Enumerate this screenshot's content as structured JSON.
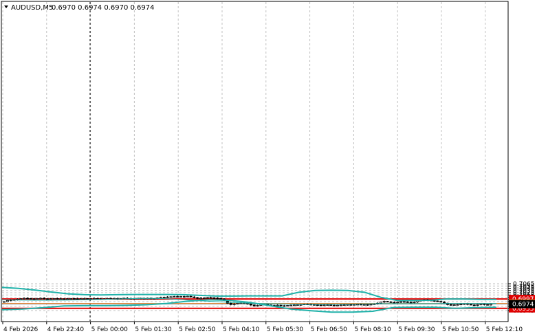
{
  "chart_data": {
    "type": "candlestick",
    "title": "AUDUSD,M5",
    "ohlc_header": "0.6970 0.6974 0.6970 0.6974",
    "ylim": [
      0.694,
      0.7071
    ],
    "yticks": [
      "0.7065",
      "0.7055",
      "0.7045",
      "0.7035",
      "0.7025",
      "0.7015",
      "0.7005",
      "0.6995",
      "0.6985",
      "0.6975",
      "0.6965",
      "0.6955",
      "0.6945"
    ],
    "xticks": [
      "4 Feb 2026",
      "4 Feb 22:40",
      "5 Feb 00:00",
      "5 Feb 01:30",
      "5 Feb 02:50",
      "5 Feb 04:10",
      "5 Feb 05:30",
      "5 Feb 06:50",
      "5 Feb 08:10",
      "5 Feb 09:30",
      "5 Feb 10:50",
      "5 Feb 12:10"
    ],
    "grid": true,
    "levels": [
      {
        "price": 0.6997,
        "label": "0.6997",
        "color": "#e00000",
        "style": "solid-thick"
      },
      {
        "price": 0.6977,
        "label": "0.6977",
        "color": "#e8791e",
        "style": "solid-thin"
      },
      {
        "price": 0.6955,
        "label": "0.6955",
        "color": "#e00000",
        "style": "solid-thick"
      }
    ],
    "current_price": {
      "price": 0.6974,
      "label": "0.6974"
    },
    "candles_close": [
      0.6985,
      0.699,
      0.6993,
      0.6994,
      0.6996,
      0.6998,
      0.7,
      0.6999,
      0.6998,
      0.6997,
      0.6999,
      0.7,
      0.6998,
      0.6997,
      0.6998,
      0.6999,
      0.6997,
      0.6998,
      0.6996,
      0.6998,
      0.6999,
      0.6998,
      0.6997,
      0.6998,
      0.6999,
      0.6998,
      0.6997,
      0.6999,
      0.6998,
      0.6997,
      0.6998,
      0.6999,
      0.6998,
      0.6999,
      0.6997,
      0.6999,
      0.7,
      0.6999,
      0.6998,
      0.6999,
      0.7,
      0.6998,
      0.6999,
      0.7,
      0.6999,
      0.6998,
      0.7001,
      0.7003,
      0.7005,
      0.7006,
      0.7007,
      0.7008,
      0.7007,
      0.7008,
      0.7007,
      0.7009,
      0.7006,
      0.7003,
      0.7,
      0.7001,
      0.7002,
      0.7003,
      0.7002,
      0.7001,
      0.7,
      0.6997,
      0.699,
      0.6978,
      0.6972,
      0.6975,
      0.6978,
      0.698,
      0.6978,
      0.6975,
      0.697,
      0.6965,
      0.6968,
      0.6972,
      0.6973,
      0.697,
      0.6968,
      0.6967,
      0.6969,
      0.6967,
      0.6966,
      0.6968,
      0.6969,
      0.697,
      0.6971,
      0.6972,
      0.6974,
      0.6973,
      0.6972,
      0.6971,
      0.697,
      0.6969,
      0.697,
      0.6971,
      0.6969,
      0.6968,
      0.6969,
      0.697,
      0.6971,
      0.6972,
      0.6971,
      0.6972,
      0.6973,
      0.6972,
      0.6972,
      0.6971,
      0.6973,
      0.6975,
      0.6978,
      0.6983,
      0.6986,
      0.6984,
      0.6982,
      0.6981,
      0.6983,
      0.6985,
      0.6984,
      0.6982,
      0.6981,
      0.6983,
      0.6988,
      0.6991,
      0.6993,
      0.6992,
      0.699,
      0.6988,
      0.6986,
      0.6983,
      0.6978,
      0.6972,
      0.697,
      0.6971,
      0.6972,
      0.6974,
      0.6976,
      0.6973,
      0.697,
      0.6968,
      0.6972,
      0.6975,
      0.6972,
      0.697,
      0.6974
    ],
    "series": [
      {
        "name": "",
        "color": "#20b2aa",
        "values": [
          0.7049,
          0.7044,
          0.7037,
          0.7028,
          0.702,
          0.7016,
          0.7015,
          0.7016,
          0.7017,
          0.7017,
          0.7017,
          0.7016,
          0.7013,
          0.701,
          0.701,
          0.7011,
          0.7011,
          0.7011,
          0.7027,
          0.7035,
          0.7036,
          0.7035,
          0.7027,
          0.7004,
          0.699,
          0.699,
          0.6991,
          0.6997,
          0.6997,
          0.6995,
          0.6995
        ]
      },
      {
        "name": "",
        "color": "#20b2aa",
        "values": [
          0.6994,
          0.6992,
          0.6991,
          0.6991,
          0.6992,
          0.6993,
          0.6995,
          0.6997,
          0.6999,
          0.7,
          0.6998,
          0.6994,
          0.6989,
          0.6985,
          0.6981,
          0.6978,
          0.6976,
          0.6975,
          0.6973,
          0.6973,
          0.6973,
          0.6974,
          0.6975,
          0.6976,
          0.6976,
          0.6976,
          0.6976,
          0.6977,
          0.6977,
          0.6977,
          0.6977
        ]
      },
      {
        "name": "",
        "color": "#20b2aa",
        "values": [
          0.6949,
          0.6952,
          0.6958,
          0.6966,
          0.6967,
          0.6967,
          0.6968,
          0.6971,
          0.6977,
          0.6987,
          0.6993,
          0.6991,
          0.6982,
          0.6967,
          0.6952,
          0.6944,
          0.6938,
          0.6938,
          0.6942,
          0.6959,
          0.696,
          0.696,
          0.6955,
          0.6958,
          0.696
        ]
      }
    ]
  }
}
